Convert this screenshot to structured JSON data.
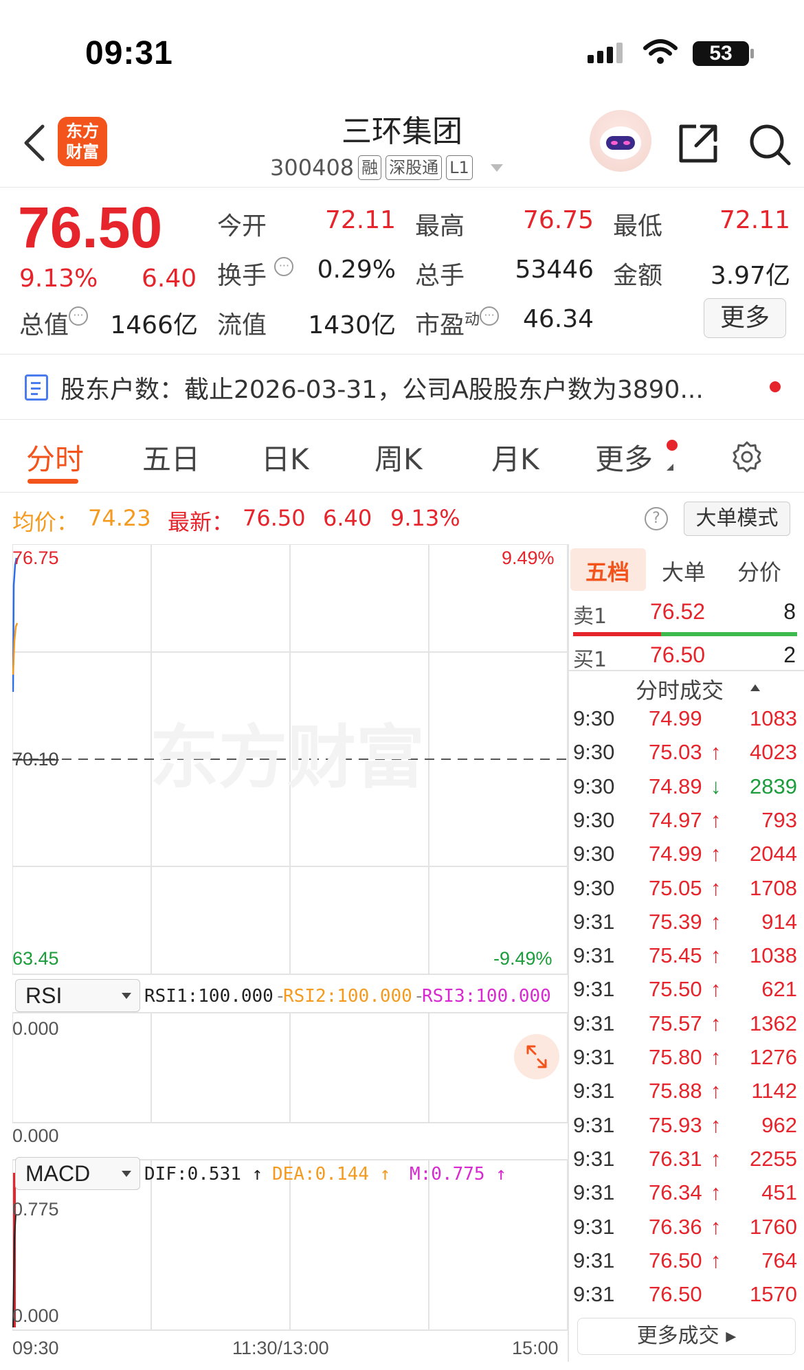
{
  "status": {
    "time": "09:31",
    "battery": "53"
  },
  "header": {
    "logo_text": "东方财富",
    "stock_name": "三环集团",
    "stock_code": "300408",
    "tags": [
      "融",
      "深股通",
      "L1"
    ]
  },
  "quote": {
    "price": "76.50",
    "change_pct": "9.13%",
    "change": "6.40",
    "fields": {
      "open_label": "今开",
      "open": "72.11",
      "high_label": "最高",
      "high": "76.75",
      "low_label": "最低",
      "low": "72.11",
      "turnover_label": "换手",
      "turnover": "0.29%",
      "volume_label": "总手",
      "volume": "53446",
      "amount_label": "金额",
      "amount": "3.97亿",
      "mktcap_label": "总值",
      "mktcap": "1466亿",
      "float_label": "流值",
      "float": "1430亿",
      "pe_label": "市盈",
      "pe_sup": "动",
      "pe": "46.34"
    },
    "more_label": "更多"
  },
  "notice": {
    "text": "股东户数：截止2026-03-31，公司A股股东户数为3890..."
  },
  "tabs": [
    "分时",
    "五日",
    "日K",
    "周K",
    "月K",
    "更多"
  ],
  "avg_bar": {
    "avg_label": "均价：",
    "avg": "74.23",
    "latest_label": "最新：",
    "latest": "76.50",
    "change": "6.40",
    "pct": "9.13%",
    "big_order_mode": "大单模式"
  },
  "chart": {
    "price_top": "76.75",
    "price_mid": "70.10",
    "price_bottom": "63.45",
    "pct_top": "9.49%",
    "pct_bottom": "-9.49%",
    "watermark": "东方财富",
    "x_labels": [
      "09:30",
      "11:30/13:00",
      "15:00"
    ],
    "rsi": {
      "selector": "RSI",
      "rsi1": "RSI1:100.000",
      "rsi2": "RSI2:100.000",
      "rsi3": "RSI3:100.000",
      "top": "0.000",
      "bottom": "0.000"
    },
    "macd": {
      "selector": "MACD",
      "dif": "DIF:0.531",
      "dea": "DEA:0.144",
      "m": "M:0.775",
      "top": "0.775",
      "bottom": "0.000"
    }
  },
  "order_book": {
    "tabs": [
      "五档",
      "大单",
      "分价"
    ],
    "sell1": {
      "label": "卖1",
      "price": "76.52",
      "vol": "8"
    },
    "buy1": {
      "label": "买1",
      "price": "76.50",
      "vol": "2"
    }
  },
  "trades": {
    "title": "分时成交",
    "rows": [
      {
        "time": "9:30",
        "price": "74.99",
        "dir": "",
        "vol": "1083",
        "vol_color": "red"
      },
      {
        "time": "9:30",
        "price": "75.03",
        "dir": "↑",
        "vol": "4023",
        "vol_color": "red"
      },
      {
        "time": "9:30",
        "price": "74.89",
        "dir": "↓",
        "vol": "2839",
        "vol_color": "green"
      },
      {
        "time": "9:30",
        "price": "74.97",
        "dir": "↑",
        "vol": "793",
        "vol_color": "red"
      },
      {
        "time": "9:30",
        "price": "74.99",
        "dir": "↑",
        "vol": "2044",
        "vol_color": "red"
      },
      {
        "time": "9:30",
        "price": "75.05",
        "dir": "↑",
        "vol": "1708",
        "vol_color": "red"
      },
      {
        "time": "9:31",
        "price": "75.39",
        "dir": "↑",
        "vol": "914",
        "vol_color": "red"
      },
      {
        "time": "9:31",
        "price": "75.45",
        "dir": "↑",
        "vol": "1038",
        "vol_color": "red"
      },
      {
        "time": "9:31",
        "price": "75.50",
        "dir": "↑",
        "vol": "621",
        "vol_color": "red"
      },
      {
        "time": "9:31",
        "price": "75.57",
        "dir": "↑",
        "vol": "1362",
        "vol_color": "red"
      },
      {
        "time": "9:31",
        "price": "75.80",
        "dir": "↑",
        "vol": "1276",
        "vol_color": "red"
      },
      {
        "time": "9:31",
        "price": "75.88",
        "dir": "↑",
        "vol": "1142",
        "vol_color": "red"
      },
      {
        "time": "9:31",
        "price": "75.93",
        "dir": "↑",
        "vol": "962",
        "vol_color": "red"
      },
      {
        "time": "9:31",
        "price": "76.31",
        "dir": "↑",
        "vol": "2255",
        "vol_color": "red"
      },
      {
        "time": "9:31",
        "price": "76.34",
        "dir": "↑",
        "vol": "451",
        "vol_color": "red"
      },
      {
        "time": "9:31",
        "price": "76.36",
        "dir": "↑",
        "vol": "1760",
        "vol_color": "red"
      },
      {
        "time": "9:31",
        "price": "76.50",
        "dir": "↑",
        "vol": "764",
        "vol_color": "red"
      },
      {
        "time": "9:31",
        "price": "76.50",
        "dir": "",
        "vol": "1570",
        "vol_color": "red"
      }
    ],
    "more_label": "更多成交"
  },
  "colors": {
    "up": "#e5242b",
    "down": "#1a9d3a",
    "accent": "#f2541b",
    "avg_line": "#f39a1f"
  }
}
